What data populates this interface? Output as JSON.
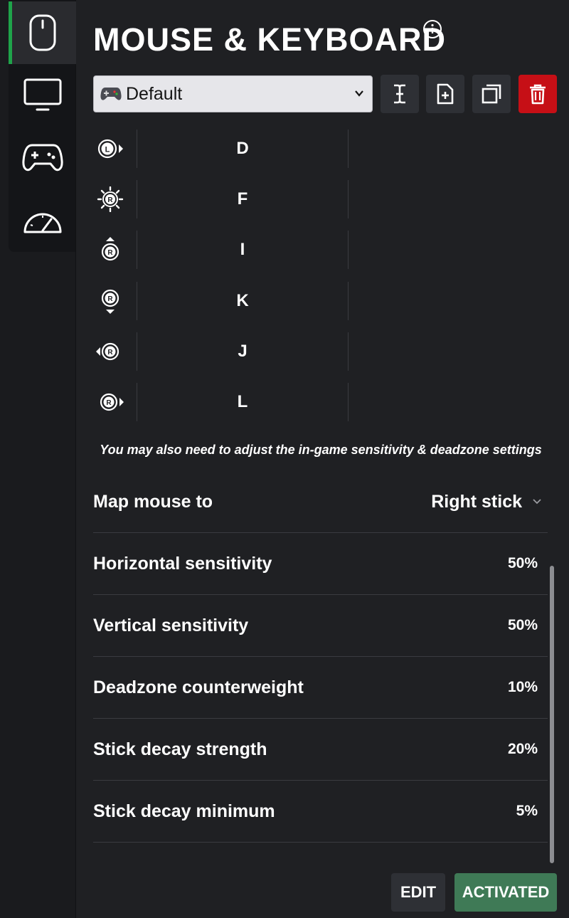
{
  "sidebar": {
    "items": [
      {
        "name": "mouse-icon",
        "active": true
      },
      {
        "name": "monitor-icon",
        "active": false
      },
      {
        "name": "gamepad-icon",
        "active": false
      },
      {
        "name": "speedometer-icon",
        "active": false
      }
    ]
  },
  "header": {
    "title": "MOUSE & KEYBOARD",
    "info_icon": "info-icon"
  },
  "toolbar": {
    "profile_value": "Default",
    "profile_icon": "gamepad-emoji-icon",
    "buttons": [
      "rename-icon",
      "new-file-icon",
      "duplicate-icon",
      "trash-icon"
    ]
  },
  "bindings": [
    {
      "icon": "left-stick-press-right-icon",
      "key": "D"
    },
    {
      "icon": "right-stick-press-icon",
      "key": "F"
    },
    {
      "icon": "right-stick-up-icon",
      "key": "I"
    },
    {
      "icon": "right-stick-down-icon",
      "key": "K"
    },
    {
      "icon": "right-stick-left-icon",
      "key": "J"
    },
    {
      "icon": "right-stick-right-icon",
      "key": "L"
    }
  ],
  "note": "You may also need to adjust the in-game sensitivity & deadzone settings",
  "settings": {
    "map_mouse_label": "Map mouse to",
    "map_mouse_value": "Right stick",
    "rows": [
      {
        "label": "Horizontal sensitivity",
        "value": "50%"
      },
      {
        "label": "Vertical sensitivity",
        "value": "50%"
      },
      {
        "label": "Deadzone counterweight",
        "value": "10%"
      },
      {
        "label": "Stick decay strength",
        "value": "20%"
      },
      {
        "label": "Stick decay minimum",
        "value": "5%"
      }
    ]
  },
  "footer": {
    "edit_label": "EDIT",
    "activated_label": "ACTIVATED"
  },
  "colors": {
    "background": "#1f2023",
    "accent_green": "#1fa34a",
    "activated_green": "#3f7a56",
    "danger_red": "#c60f16"
  }
}
